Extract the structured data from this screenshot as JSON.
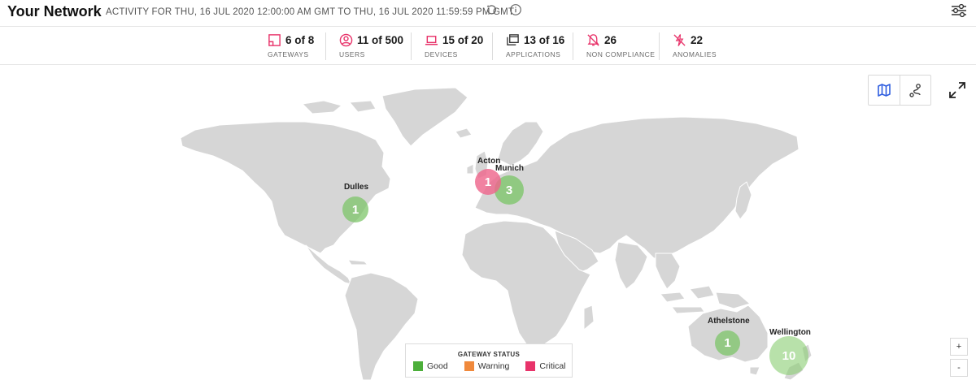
{
  "header": {
    "title": "Your Network",
    "activity": "ACTIVITY FOR THU, 16 JUL 2020 12:00:00 AM GMT TO THU, 16 JUL 2020 11:59:59 PM GMT"
  },
  "stats": [
    {
      "icon": "gateway-icon",
      "value": "6 of 8",
      "label": "GATEWAYS"
    },
    {
      "icon": "user-icon",
      "value": "11 of 500",
      "label": "USERS"
    },
    {
      "icon": "laptop-icon",
      "value": "15 of 20",
      "label": "DEVICES"
    },
    {
      "icon": "applications-icon",
      "value": "13 of 16",
      "label": "APPLICATIONS"
    },
    {
      "icon": "non-compliance-icon",
      "value": "26",
      "label": "NON COMPLIANCE"
    },
    {
      "icon": "anomaly-icon",
      "value": "22",
      "label": "ANOMALIES"
    }
  ],
  "colors": {
    "accent": "#e8336a",
    "good": "#4caf3a",
    "warning": "#f0893c",
    "critical": "#e8336a",
    "land": "#d6d6d6"
  },
  "gateways": [
    {
      "name": "Dulles",
      "count": "1",
      "status": "good"
    },
    {
      "name": "Acton",
      "count": "1",
      "status": "critical"
    },
    {
      "name": "Munich",
      "count": "3",
      "status": "good"
    },
    {
      "name": "Athelstone",
      "count": "1",
      "status": "good"
    },
    {
      "name": "Wellington",
      "count": "10",
      "status": "good"
    }
  ],
  "legend": {
    "title": "GATEWAY STATUS",
    "good": "Good",
    "warning": "Warning",
    "critical": "Critical"
  },
  "zoom": {
    "in": "+",
    "out": "-"
  }
}
